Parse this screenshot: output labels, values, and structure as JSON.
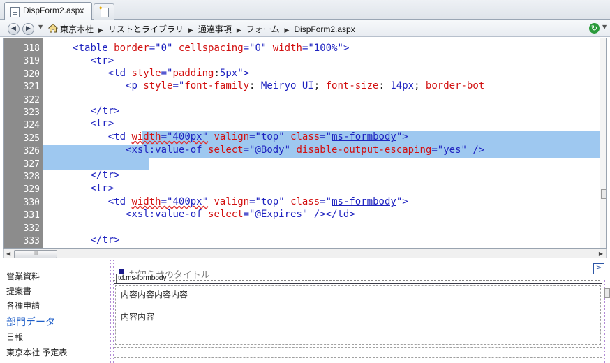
{
  "window": {
    "tab_title": "DispForm2.aspx"
  },
  "breadcrumb": {
    "items": [
      "東京本社",
      "リストとライブラリ",
      "通達事項",
      "フォーム",
      "DispForm2.aspx"
    ]
  },
  "editor": {
    "line_numbers": [
      "318",
      "319",
      "320",
      "321",
      "322",
      "323",
      "324",
      "325",
      "326",
      "327",
      "328",
      "329",
      "330",
      "331",
      "332",
      "333"
    ]
  },
  "hscroll": {
    "thumb_label": "III"
  },
  "left_nav": {
    "items": [
      "営業資料",
      "提案書",
      "各種申請",
      "部門データ",
      "日報",
      "東京本社 予定表"
    ]
  },
  "design": {
    "field_title": "お知らせのタイトル",
    "tag_label": "td.ms-formbody",
    "body_lines": [
      "内容内容内容内容",
      "内容内容"
    ],
    "expand_label": ">"
  },
  "colors": {
    "tag": "#1f23c0",
    "attribute": "#d21010",
    "selection": "#9ec8f0",
    "gutter": "#8c8c8c",
    "highlight_nav": "#1e5ec8"
  }
}
